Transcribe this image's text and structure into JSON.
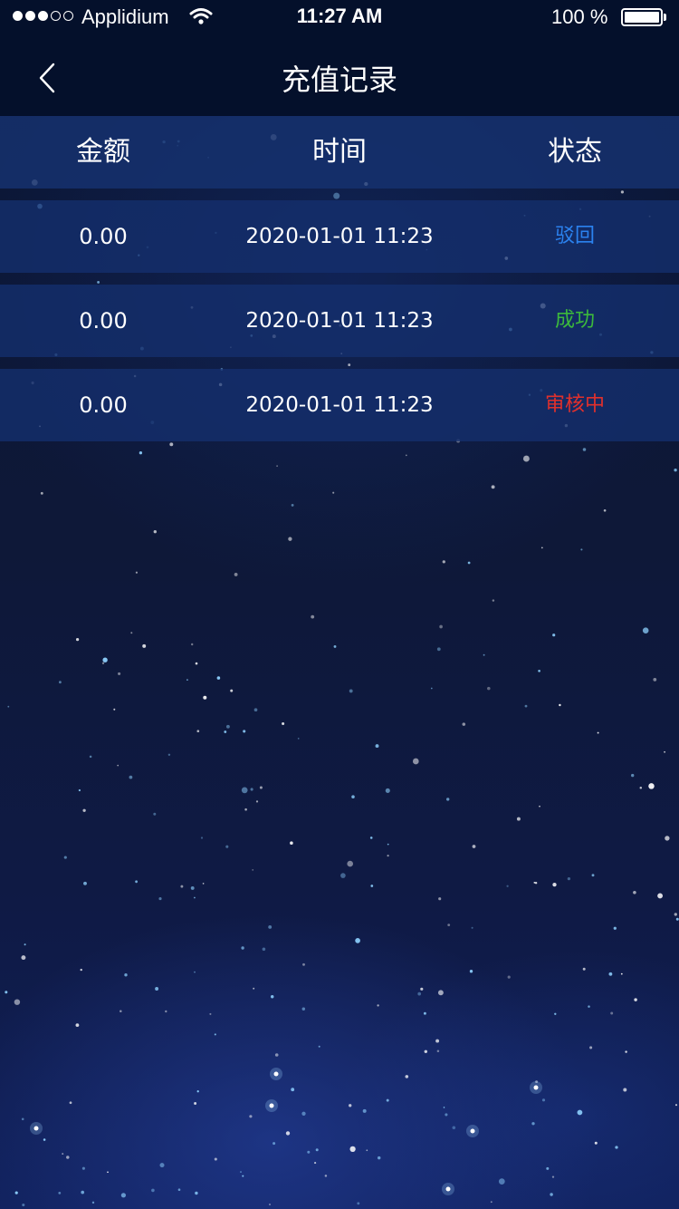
{
  "status_bar": {
    "carrier": "Applidium",
    "time": "11:27 AM",
    "battery": "100 %",
    "signal_bars_filled": 3,
    "signal_bars_total": 5,
    "icons": [
      "signal-dots-icon",
      "wifi-icon",
      "battery-icon"
    ]
  },
  "nav": {
    "title": "充值记录",
    "back_icon": "chevron-left-icon"
  },
  "table": {
    "columns": [
      "金额",
      "时间",
      "状态"
    ],
    "rows": [
      {
        "amount": "0.00",
        "time": "2020-01-01 11:23",
        "status": "驳回",
        "status_color": "#2b82ef"
      },
      {
        "amount": "0.00",
        "time": "2020-01-01 11:23",
        "status": "成功",
        "status_color": "#3cb93c"
      },
      {
        "amount": "0.00",
        "time": "2020-01-01 11:23",
        "status": "审核中",
        "status_color": "#e0302c"
      }
    ]
  },
  "colors": {
    "bar_background": "#04102b",
    "row_background": "#14306e",
    "page_background": "#0e1536"
  }
}
